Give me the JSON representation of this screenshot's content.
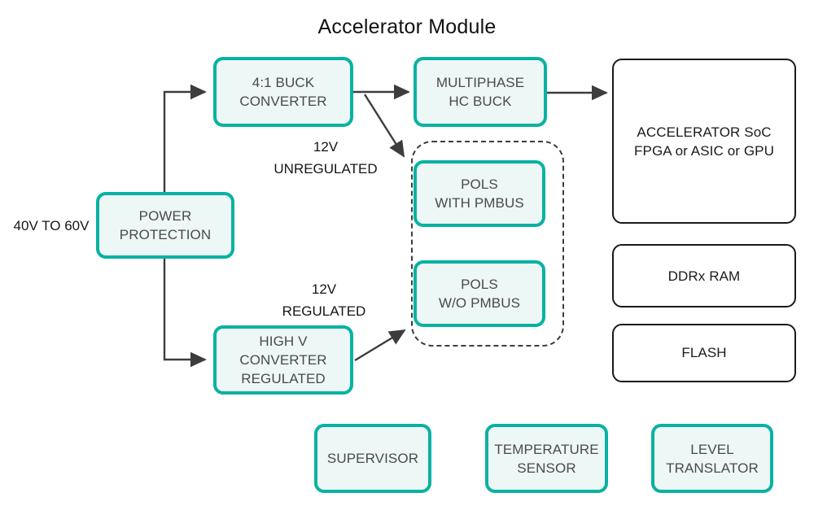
{
  "diagram": {
    "title": "Accelerator Module",
    "type": "block-diagram",
    "colors": {
      "accent_teal": "#08b2a2",
      "teal_fill": "#edf7f5",
      "plain_border": "#1a1a1a",
      "wire": "#3d3d3d",
      "text": "#1a1a1a"
    },
    "input_label": "40V TO 60V",
    "blocks": [
      {
        "id": "power-protection",
        "style": "teal",
        "lines": [
          "POWER",
          "PROTECTION"
        ]
      },
      {
        "id": "buck-converter",
        "style": "teal",
        "lines": [
          "4:1 BUCK",
          "CONVERTER"
        ]
      },
      {
        "id": "multiphase-hc-buck",
        "style": "teal",
        "lines": [
          "MULTIPHASE",
          "HC BUCK"
        ]
      },
      {
        "id": "high-v-converter",
        "style": "teal",
        "lines": [
          "HIGH V",
          "CONVERTER",
          "REGULATED"
        ]
      },
      {
        "id": "pols-with-pmbus",
        "style": "teal",
        "lines": [
          "POLS",
          "WITH PMBUS"
        ]
      },
      {
        "id": "pols-wo-pmbus",
        "style": "teal",
        "lines": [
          "POLS",
          "W/O PMBUS"
        ]
      },
      {
        "id": "accelerator-soc",
        "style": "plain",
        "lines": [
          "ACCELERATOR SoC",
          "FPGA or ASIC or GPU"
        ]
      },
      {
        "id": "ddrx-ram",
        "style": "plain",
        "lines": [
          "DDRx RAM"
        ]
      },
      {
        "id": "flash",
        "style": "plain",
        "lines": [
          "FLASH"
        ]
      },
      {
        "id": "supervisor",
        "style": "teal",
        "lines": [
          "SUPERVISOR"
        ]
      },
      {
        "id": "temperature-sensor",
        "style": "teal",
        "lines": [
          "TEMPERATURE",
          "SENSOR"
        ]
      },
      {
        "id": "level-translator",
        "style": "teal",
        "lines": [
          "LEVEL",
          "TRANSLATOR"
        ]
      }
    ],
    "rail_labels": [
      {
        "id": "rail-unregulated",
        "lines": [
          "12V",
          "UNREGULATED"
        ]
      },
      {
        "id": "rail-regulated",
        "lines": [
          "12V",
          "REGULATED"
        ]
      }
    ],
    "connections": [
      {
        "from": "power-protection",
        "to": "buck-converter",
        "arrow": true
      },
      {
        "from": "power-protection",
        "to": "high-v-converter",
        "arrow": true
      },
      {
        "from": "buck-converter",
        "to": "multiphase-hc-buck",
        "arrow": true,
        "rail": "12V UNREGULATED"
      },
      {
        "from": "buck-converter",
        "to": "pol-group",
        "arrow": true,
        "rail": "12V UNREGULATED"
      },
      {
        "from": "high-v-converter",
        "to": "pol-group",
        "arrow": true,
        "rail": "12V REGULATED"
      },
      {
        "from": "multiphase-hc-buck",
        "to": "accelerator-soc",
        "arrow": true
      }
    ]
  },
  "blocks": {
    "power_protection": {
      "l0": "POWER",
      "l1": "PROTECTION"
    },
    "buck_converter": {
      "l0": "4:1 BUCK",
      "l1": "CONVERTER"
    },
    "multiphase": {
      "l0": "MULTIPHASE",
      "l1": "HC BUCK"
    },
    "high_v": {
      "l0": "HIGH V",
      "l1": "CONVERTER",
      "l2": "REGULATED"
    },
    "pols_with": {
      "l0": "POLS",
      "l1": "WITH PMBUS"
    },
    "pols_wo": {
      "l0": "POLS",
      "l1": "W/O PMBUS"
    },
    "accelerator": {
      "l0": "ACCELERATOR SoC",
      "l1": "FPGA or ASIC or GPU"
    },
    "ddrx": {
      "l0": "DDRx RAM"
    },
    "flash": {
      "l0": "FLASH"
    },
    "supervisor": {
      "l0": "SUPERVISOR"
    },
    "temperature": {
      "l0": "TEMPERATURE",
      "l1": "SENSOR"
    },
    "level_translator": {
      "l0": "LEVEL",
      "l1": "TRANSLATOR"
    }
  },
  "labels": {
    "input": "40V TO 60V",
    "unreg_l0": "12V",
    "unreg_l1": "UNREGULATED",
    "reg_l0": "12V",
    "reg_l1": "REGULATED"
  }
}
